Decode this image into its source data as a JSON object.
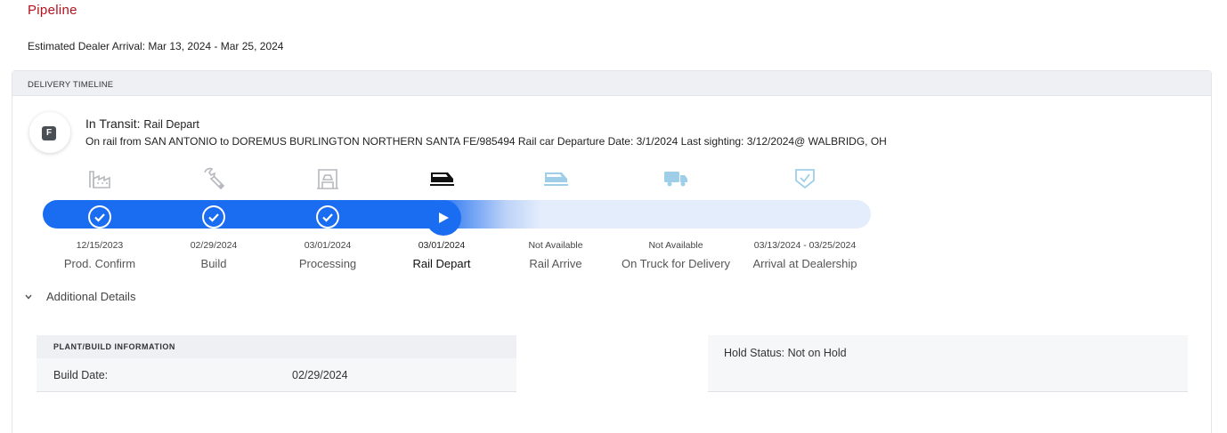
{
  "pipeline": {
    "title": "Pipeline",
    "estimated_arrival": "Estimated Dealer Arrival: Mar 13, 2024 - Mar 25, 2024"
  },
  "delivery": {
    "header": "DELIVERY TIMELINE",
    "badge_letter": "F",
    "status_label": "In Transit:",
    "status_value": "Rail Depart",
    "detail": "On rail from SAN ANTONIO to DOREMUS BURLINGTON NORTHERN SANTA FE/985494 Rail car Departure Date: 3/1/2024 Last sighting: 3/12/2024@ WALBRIDG, OH",
    "progress_color": "#1a6cf0",
    "steps": [
      {
        "icon": "factory-icon",
        "date": "12/15/2023",
        "label": "Prod. Confirm",
        "state": "complete"
      },
      {
        "icon": "wrench-icon",
        "date": "02/29/2024",
        "label": "Build",
        "state": "complete"
      },
      {
        "icon": "processing-icon",
        "date": "03/01/2024",
        "label": "Processing",
        "state": "complete"
      },
      {
        "icon": "rail-icon",
        "date": "03/01/2024",
        "label": "Rail Depart",
        "state": "current"
      },
      {
        "icon": "rail-icon",
        "date": "Not Available",
        "label": "Rail Arrive",
        "state": "pending"
      },
      {
        "icon": "truck-icon",
        "date": "Not Available",
        "label": "On Truck for Delivery",
        "state": "pending"
      },
      {
        "icon": "shield-check-icon",
        "date": "03/13/2024 - 03/25/2024",
        "label": "Arrival at Dealership",
        "state": "pending"
      }
    ]
  },
  "additional": {
    "label": "Additional Details"
  },
  "plant": {
    "header": "PLANT/BUILD INFORMATION",
    "build_date_label": "Build Date:",
    "build_date_value": "02/29/2024"
  },
  "hold": {
    "text": "Hold Status: Not on Hold"
  }
}
